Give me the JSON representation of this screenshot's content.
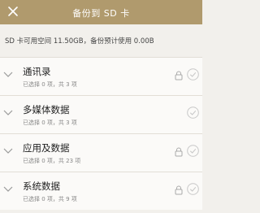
{
  "header": {
    "title": "备份到 SD 卡"
  },
  "info": {
    "text": "SD 卡可用空间 11.50GB，备份预计使用 0.00B"
  },
  "items": [
    {
      "name": "通讯录",
      "sub": "已选择 0 项，共 3 项",
      "locked": true
    },
    {
      "name": "多媒体数据",
      "sub": "已选择 0 项，共 3 项",
      "locked": false
    },
    {
      "name": "应用及数据",
      "sub": "已选择 0 项，共 23 项",
      "locked": true
    },
    {
      "name": "系统数据",
      "sub": "已选择 0 项，共 9 项",
      "locked": true
    }
  ]
}
